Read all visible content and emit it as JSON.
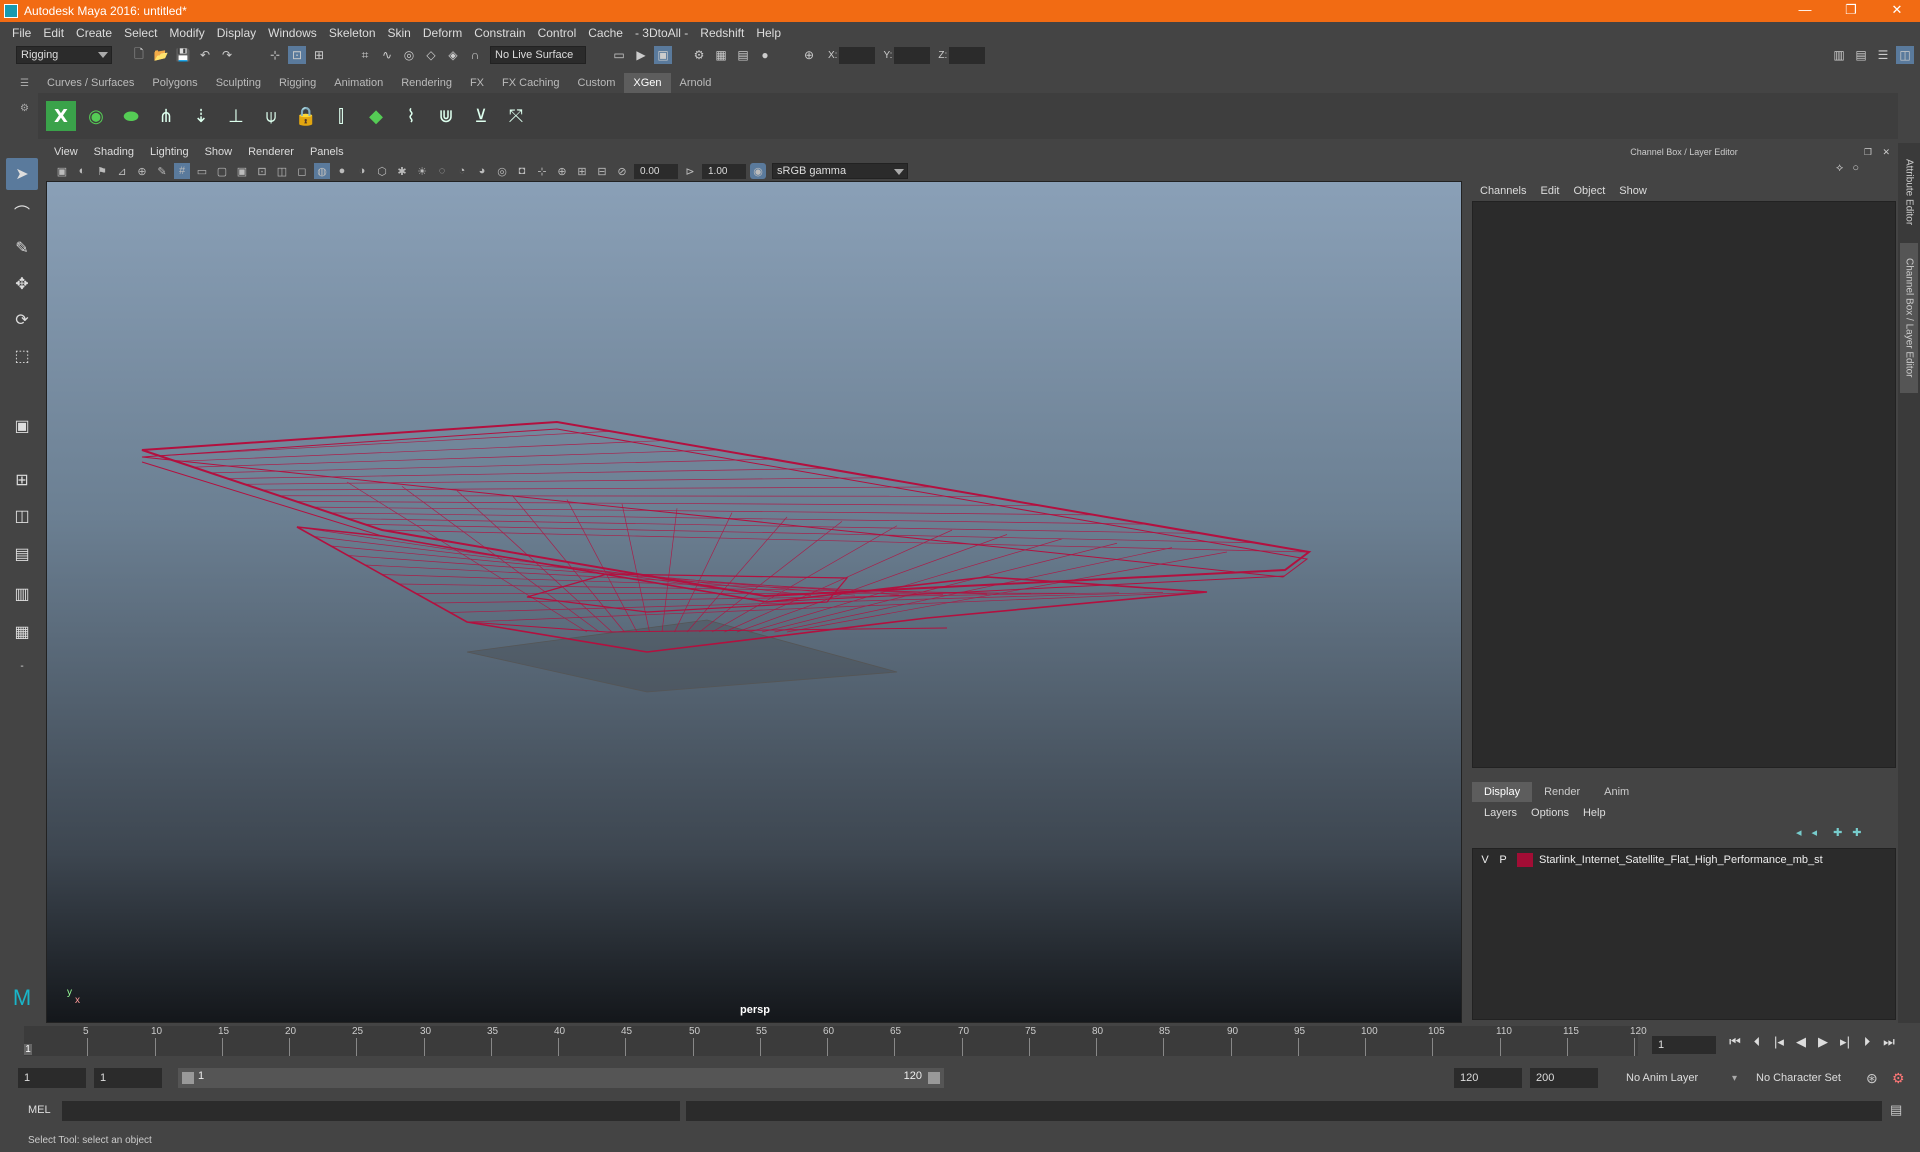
{
  "window": {
    "title": "Autodesk Maya 2016: untitled*",
    "min": "—",
    "max": "❐",
    "close": "✕"
  },
  "menus": [
    "File",
    "Edit",
    "Create",
    "Select",
    "Modify",
    "Display",
    "Windows",
    "Skeleton",
    "Skin",
    "Deform",
    "Constrain",
    "Control",
    "Cache",
    "- 3DtoAll -",
    "Redshift",
    "Help"
  ],
  "status": {
    "menuset": "Rigging",
    "live_surface": "No Live Surface",
    "x_label": "X:",
    "y_label": "Y:",
    "z_label": "Z:"
  },
  "shelf_tabs": [
    "Curves / Surfaces",
    "Polygons",
    "Sculpting",
    "Rigging",
    "Animation",
    "Rendering",
    "FX",
    "FX Caching",
    "Custom",
    "XGen",
    "Arnold"
  ],
  "shelf_active": "XGen",
  "viewport": {
    "menus": [
      "View",
      "Shading",
      "Lighting",
      "Show",
      "Renderer",
      "Panels"
    ],
    "exposure": "0.00",
    "gamma": "1.00",
    "color_space": "sRGB gamma",
    "camera": "persp",
    "axis_y": "y",
    "axis_x": "x"
  },
  "channel_box": {
    "title": "Channel Box / Layer Editor",
    "menus": [
      "Channels",
      "Edit",
      "Object",
      "Show"
    ]
  },
  "layer_editor": {
    "tabs": [
      "Display",
      "Render",
      "Anim"
    ],
    "active_tab": "Display",
    "menus": [
      "Layers",
      "Options",
      "Help"
    ],
    "layers": [
      {
        "v": "V",
        "p": "P",
        "name": "Starlink_Internet_Satellite_Flat_High_Performance_mb_st",
        "color": "#a20d35"
      }
    ]
  },
  "side_tabs": [
    "Attribute Editor",
    "Channel Box / Layer Editor"
  ],
  "timeline": {
    "labels": [
      "5",
      "10",
      "15",
      "20",
      "25",
      "30",
      "35",
      "40",
      "45",
      "50",
      "55",
      "60",
      "65",
      "70",
      "75",
      "80",
      "85",
      "90",
      "95",
      "100",
      "105",
      "110",
      "115",
      "120"
    ],
    "current_frame_marker": "1",
    "current_frame": "1"
  },
  "range": {
    "start": "1",
    "playback_start": "1",
    "slider_start": "1",
    "slider_end": "120",
    "playback_end": "120",
    "end": "200",
    "anim_layer": "No Anim Layer",
    "char_set": "No Character Set"
  },
  "command": {
    "lang": "MEL"
  },
  "help_line": "Select Tool: select an object",
  "colors": {
    "titlebar": "#f26b13",
    "wire": "#b3103f",
    "accent": "#5a7a9c"
  }
}
